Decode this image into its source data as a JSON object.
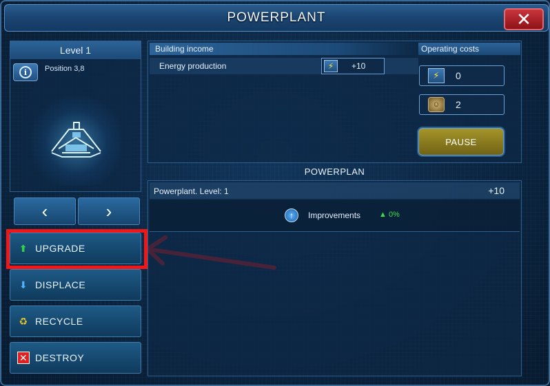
{
  "window": {
    "title": "POWERPLANT",
    "close_label": "✕"
  },
  "building": {
    "level_label": "Level 1",
    "info_label": "i",
    "position_label": "Position 3,8"
  },
  "nav": {
    "prev_label": "‹",
    "next_label": "›"
  },
  "actions": {
    "upgrade_label": "UPGRADE",
    "displace_label": "DISPLACE",
    "recycle_label": "RECYCLE",
    "destroy_label": "DESTROY"
  },
  "income": {
    "header": "Building income",
    "energy_label": "Energy production",
    "energy_value": "+10"
  },
  "costs": {
    "header": "Operating costs",
    "energy_value": "0",
    "workers_value": "2"
  },
  "pause_label": "PAUSE",
  "powerplan": {
    "title": "POWERPLAN",
    "row_label": "Powerplant. Level: 1",
    "row_value": "+10",
    "improvements_label": "Improvements",
    "improvements_value": "▲ 0%"
  },
  "colors": {
    "highlight": "#ef1717",
    "positive": "#39e04b",
    "pause": "#a7962a"
  }
}
